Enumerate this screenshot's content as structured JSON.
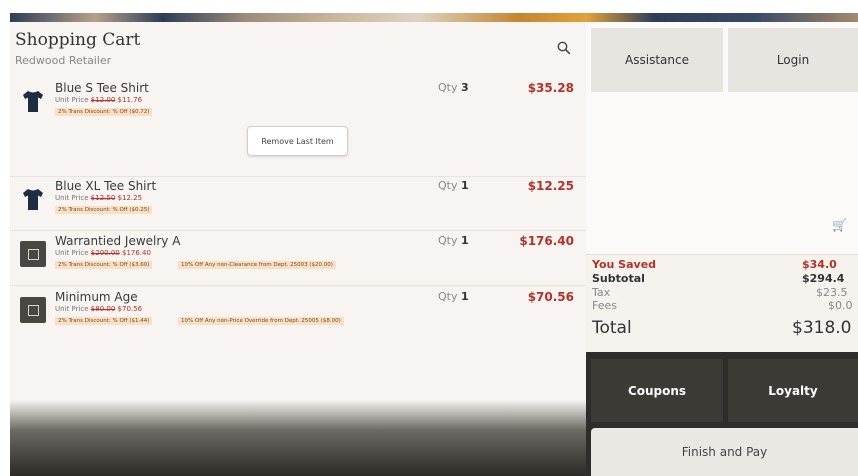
{
  "cart": {
    "title": "Shopping Cart",
    "subtitle": "Redwood Retailer",
    "remove_label": "Remove Last Item",
    "items": [
      {
        "name": "Blue S Tee Shirt",
        "unit_label": "Unit Price",
        "old_price": "$12.00",
        "new_price": "$11.76",
        "discounts": [
          "2% Trans Discount: % Off ($0.72)"
        ],
        "qty_label": "Qty",
        "qty": "3",
        "amount": "$35.28",
        "icon": "tshirt-icon"
      },
      {
        "name": "Blue XL Tee Shirt",
        "unit_label": "Unit Price",
        "old_price": "$12.50",
        "new_price": "$12.25",
        "discounts": [
          "2% Trans Discount: % Off ($0.25)"
        ],
        "qty_label": "Qty",
        "qty": "1",
        "amount": "$12.25",
        "icon": "tshirt-icon"
      },
      {
        "name": "Warrantied Jewelry A",
        "unit_label": "Unit Price",
        "old_price": "$200.00",
        "new_price": "$176.40",
        "discounts": [
          "2% Trans Discount: % Off ($3.60)",
          "10% Off Any non-Clearance from Dept. 25003 ($20.00)"
        ],
        "qty_label": "Qty",
        "qty": "1",
        "amount": "$176.40",
        "icon": "product-placeholder-icon"
      },
      {
        "name": "Minimum Age",
        "unit_label": "Unit Price",
        "old_price": "$80.00",
        "new_price": "$70.56",
        "discounts": [
          "2% Trans Discount: % Off ($1.44)",
          "10% Off Any non-Price Override from Dept. 25005 ($8.00)"
        ],
        "qty_label": "Qty",
        "qty": "1",
        "amount": "$70.56",
        "icon": "product-placeholder-icon"
      }
    ]
  },
  "side": {
    "assistance_label": "Assistance",
    "login_label": "Login",
    "totals": {
      "saved_label": "You Saved",
      "saved": "$34.0",
      "subtotal_label": "Subtotal",
      "subtotal": "$294.4",
      "tax_label": "Tax",
      "tax": "$23.5",
      "fees_label": "Fees",
      "fees": "$0.0",
      "total_label": "Total",
      "total": "$318.0"
    },
    "coupons_label": "Coupons",
    "loyalty_label": "Loyalty",
    "finish_label": "Finish and Pay"
  },
  "colors": {
    "accent_red": "#b5312a",
    "dark_panel": "#2f2c29",
    "discount_bg": "#f9dfc5"
  }
}
